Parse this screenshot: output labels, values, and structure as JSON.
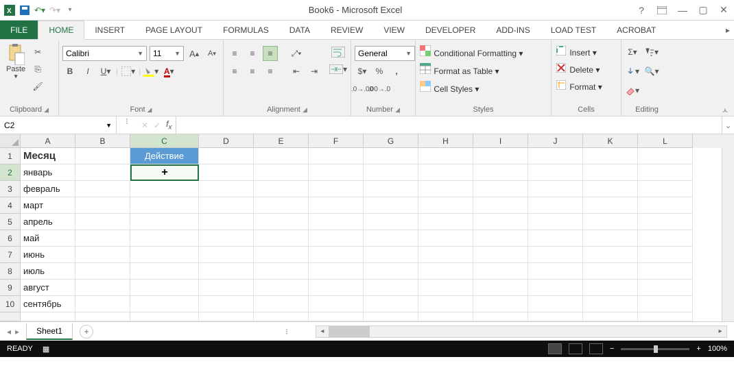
{
  "title": "Book6 - Microsoft Excel",
  "tabs": {
    "file": "FILE",
    "items": [
      "HOME",
      "INSERT",
      "PAGE LAYOUT",
      "FORMULAS",
      "DATA",
      "REVIEW",
      "VIEW",
      "DEVELOPER",
      "ADD-INS",
      "LOAD TEST",
      "ACROBAT"
    ],
    "active": "HOME"
  },
  "ribbon": {
    "clipboard": {
      "label": "Clipboard",
      "paste": "Paste"
    },
    "font": {
      "label": "Font",
      "name": "Calibri",
      "size": "11"
    },
    "alignment": {
      "label": "Alignment"
    },
    "number": {
      "label": "Number",
      "format": "General"
    },
    "styles": {
      "label": "Styles",
      "cf": "Conditional Formatting",
      "fat": "Format as Table",
      "cs": "Cell Styles"
    },
    "cells": {
      "label": "Cells",
      "insert": "Insert",
      "delete": "Delete",
      "format": "Format"
    },
    "editing": {
      "label": "Editing"
    }
  },
  "namebox": "C2",
  "columns": [
    "A",
    "B",
    "C",
    "D",
    "E",
    "F",
    "G",
    "H",
    "I",
    "J",
    "K",
    "L"
  ],
  "rows": [
    {
      "n": "1",
      "cells": {
        "A": "Месяц",
        "C": "Действие"
      }
    },
    {
      "n": "2",
      "cells": {
        "A": "январь"
      }
    },
    {
      "n": "3",
      "cells": {
        "A": "февраль"
      }
    },
    {
      "n": "4",
      "cells": {
        "A": "март"
      }
    },
    {
      "n": "5",
      "cells": {
        "A": "апрель"
      }
    },
    {
      "n": "6",
      "cells": {
        "A": "май"
      }
    },
    {
      "n": "7",
      "cells": {
        "A": "июнь"
      }
    },
    {
      "n": "8",
      "cells": {
        "A": "июль"
      }
    },
    {
      "n": "9",
      "cells": {
        "A": "август"
      }
    },
    {
      "n": "10",
      "cells": {
        "A": "сентябрь"
      }
    }
  ],
  "sheet": "Sheet1",
  "status": {
    "ready": "READY",
    "zoom": "100%"
  },
  "active_cell": "C2"
}
